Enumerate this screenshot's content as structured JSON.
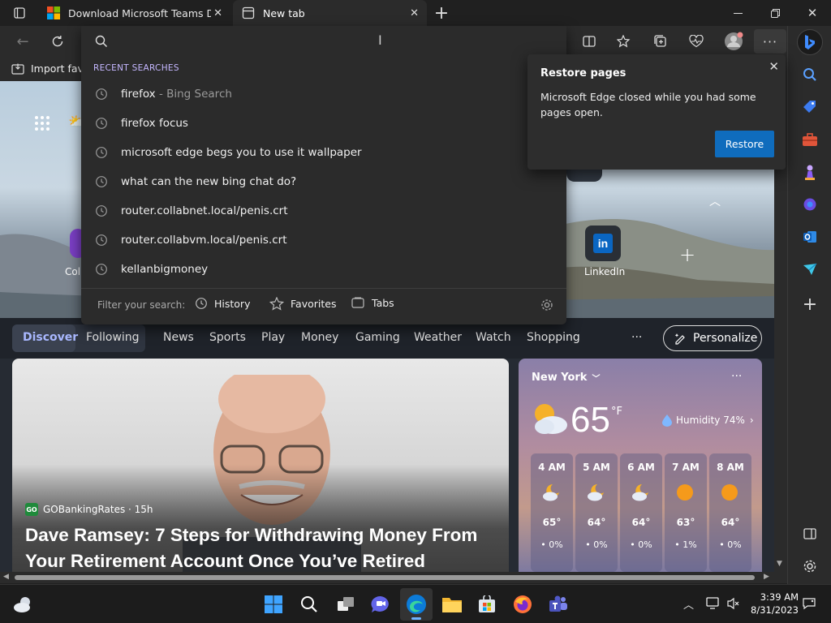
{
  "tabs": [
    {
      "title": "Download Microsoft Teams Desk",
      "active": false
    },
    {
      "title": "New tab",
      "active": true
    }
  ],
  "address_bar": {
    "value": "",
    "placeholder": ""
  },
  "favorites_bar": {
    "import_label": "Import favo"
  },
  "dropdown": {
    "header": "RECENT SEARCHES",
    "suggestions": [
      {
        "text": "firefox",
        "suffix": " - Bing Search"
      },
      {
        "text": "firefox focus",
        "suffix": ""
      },
      {
        "text": "microsoft edge begs you to use it wallpaper",
        "suffix": ""
      },
      {
        "text": "what can the new bing chat do?",
        "suffix": ""
      },
      {
        "text": "router.collabnet.local/penis.crt",
        "suffix": ""
      },
      {
        "text": "router.collabvm.local/penis.crt",
        "suffix": ""
      },
      {
        "text": "kellanbigmoney",
        "suffix": ""
      }
    ],
    "filter_label": "Filter your search:",
    "filters": [
      "History",
      "Favorites",
      "Tabs"
    ]
  },
  "restore_popup": {
    "title": "Restore pages",
    "message": "Microsoft Edge closed while you had some pages open.",
    "button": "Restore"
  },
  "quick_links": {
    "partial_left_label": "Coll",
    "linkedin_label": "LinkedIn"
  },
  "feed_nav": {
    "pills": [
      "Discover",
      "Following"
    ],
    "items": [
      "News",
      "Sports",
      "Play",
      "Money",
      "Gaming",
      "Weather",
      "Watch",
      "Shopping"
    ],
    "more": "···",
    "personalize": "Personalize"
  },
  "news_card": {
    "source_badge": "GO",
    "source": "GOBankingRates · 15h",
    "headline": "Dave Ramsey: 7 Steps for Withdrawing Money From Your Retirement Account Once You’ve Retired"
  },
  "weather": {
    "location": "New York",
    "temperature": "65",
    "unit": "°F",
    "humidity": "Humidity 74%",
    "hourly": [
      {
        "time": "4 AM",
        "temp": "65°",
        "precip": "0%",
        "icon": "partly-cloudy-night"
      },
      {
        "time": "5 AM",
        "temp": "64°",
        "precip": "0%",
        "icon": "partly-cloudy-night"
      },
      {
        "time": "6 AM",
        "temp": "64°",
        "precip": "0%",
        "icon": "partly-cloudy-night"
      },
      {
        "time": "7 AM",
        "temp": "63°",
        "precip": "1%",
        "icon": "sun"
      },
      {
        "time": "8 AM",
        "temp": "64°",
        "precip": "0%",
        "icon": "sun"
      }
    ]
  },
  "clock": {
    "time": "3:39 AM",
    "date": "8/31/2023"
  },
  "colors": {
    "accent": "#0f6cbd",
    "link_purple": "#c5b7ff",
    "bing_blue": "#1f5ad1"
  }
}
